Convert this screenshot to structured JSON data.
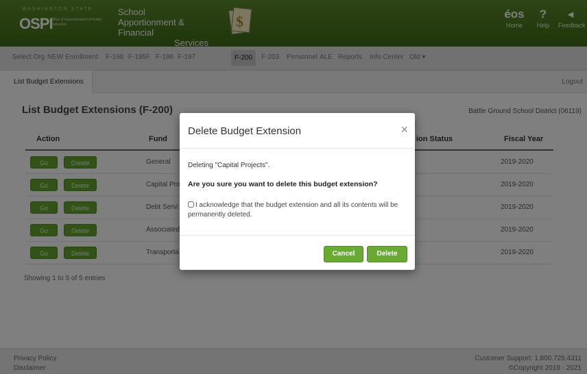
{
  "header": {
    "org_state": "WASHINGTON STATE",
    "org_mark": "OSPI",
    "org_sub": "Office of Superintendent of Public Instruction",
    "app_title_lines": [
      "School",
      "Apportionment & Financial",
      "Services"
    ],
    "buttons": [
      {
        "label": "Home",
        "glyph": "éos"
      },
      {
        "label": "Help",
        "glyph": "?"
      },
      {
        "label": "Feedback",
        "glyph": "◂"
      }
    ]
  },
  "nav": {
    "items": [
      "Select Org",
      "NEW Enrollment",
      "F-198",
      "F-195F",
      "F-196",
      "F-197",
      "F-200",
      "F-203",
      "Personnel",
      "ALE",
      "Reports",
      "Info Center",
      "Old ▾"
    ],
    "active": "F-200"
  },
  "subnav": {
    "tab": "List Budget Extensions",
    "logout": "Logout"
  },
  "main": {
    "title": "List Budget Extensions (F-200)",
    "district": "Battle Ground School District (06119)",
    "columns": {
      "action": "Action",
      "fund": "Fund",
      "status": "ion Status",
      "fiscal_year": "Fiscal Year"
    },
    "rows": [
      {
        "go": "Go",
        "action2": "Create",
        "fund": "General",
        "year": "2019-2020"
      },
      {
        "go": "Go",
        "action2": "Delete",
        "fund": "Capital Pro",
        "year": "2019-2020"
      },
      {
        "go": "Go",
        "action2": "Delete",
        "fund": "Debt Servi",
        "year": "2019-2020"
      },
      {
        "go": "Go",
        "action2": "Delete",
        "fund": "Associated",
        "year": "2019-2020"
      },
      {
        "go": "Go",
        "action2": "Delete",
        "fund": "Transporta",
        "year": "2019-2020"
      }
    ],
    "showing": "Showing 1 to 5 of 5 entries"
  },
  "footer": {
    "privacy": "Privacy Policy",
    "disclaimer": "Disclaimer",
    "support": "Customer Support: 1.800.725.4311",
    "copyright": "©Copyright 2019 - 2021"
  },
  "modal": {
    "title": "Delete Budget Extension",
    "close": "×",
    "deleting": "Deleting \"Capital Projects\".",
    "question": "Are you sure you want to delete this budget extension?",
    "acknowledge": "I acknowledge that the budget extension and all its contents will be permanently deleted.",
    "cancel": "Cancel",
    "delete": "Delete"
  }
}
